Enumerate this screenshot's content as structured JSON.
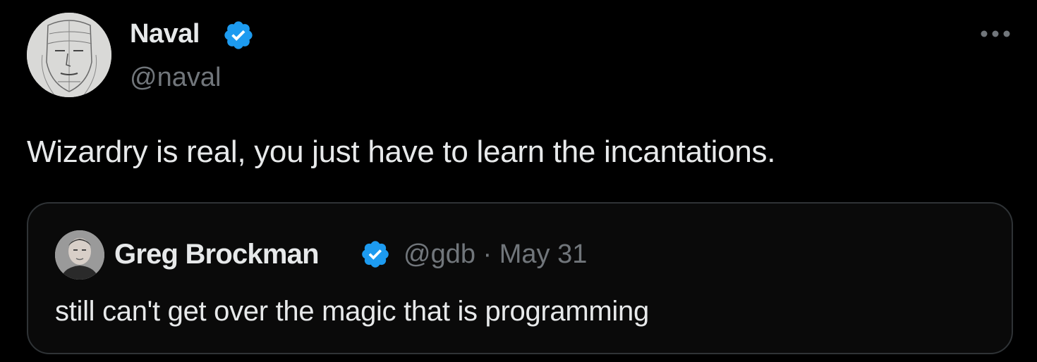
{
  "tweet": {
    "author": {
      "display_name": "Naval",
      "handle": "@naval",
      "verified": true,
      "avatar_icon": "sketch-face-avatar"
    },
    "text": "Wizardry is real, you just have to learn the incantations.",
    "more_icon": "more-horizontal-icon"
  },
  "quote": {
    "author": {
      "display_name": "Greg Brockman",
      "handle": "@gdb",
      "verified": true,
      "avatar_icon": "photo-avatar"
    },
    "separator": "·",
    "date": "May 31",
    "text": "still can't get over the magic that is programming"
  },
  "colors": {
    "background": "#000000",
    "primary_text": "#e7e9ea",
    "secondary_text": "#71767b",
    "verified_badge": "#1d9bf0",
    "border": "#2f3336"
  }
}
